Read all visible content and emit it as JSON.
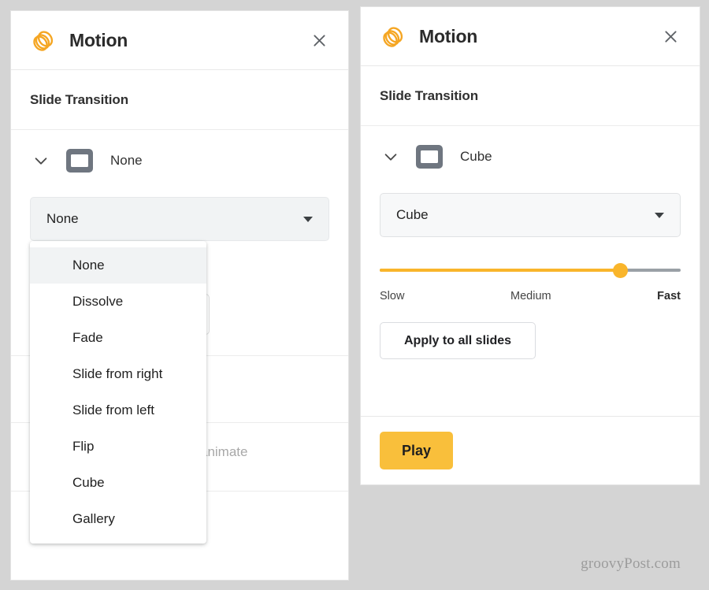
{
  "colors": {
    "brand_orange": "#F5A623",
    "accent_yellow": "#F9BF3B",
    "slider_fill": "#F9B52B",
    "panel_bg": "#FFFFFF",
    "page_bg": "#D4D4D4",
    "select_bg": "#F1F3F4",
    "thumb_gray": "#6F7680"
  },
  "left_panel": {
    "header": {
      "logo_icon": "motion-stacked-circles-icon",
      "title": "Motion",
      "close_icon": "close-icon"
    },
    "section": {
      "title": "Slide Transition"
    },
    "transition_row": {
      "chevron_icon": "chevron-down-icon",
      "slide_icon": "slide-thumbnail-icon",
      "name": "None"
    },
    "select": {
      "value": "None",
      "caret_icon": "caret-down-icon",
      "open": true
    },
    "dropdown": {
      "selected": "None",
      "options": [
        "None",
        "Dissolve",
        "Fade",
        "Slide from right",
        "Slide from left",
        "Flip",
        "Cube",
        "Gallery"
      ]
    },
    "background_content": {
      "placeholder_text": "animate"
    }
  },
  "right_panel": {
    "header": {
      "logo_icon": "motion-stacked-circles-icon",
      "title": "Motion",
      "close_icon": "close-icon"
    },
    "section": {
      "title": "Slide Transition"
    },
    "transition_row": {
      "chevron_icon": "chevron-down-icon",
      "slide_icon": "slide-thumbnail-icon",
      "name": "Cube"
    },
    "select": {
      "value": "Cube",
      "caret_icon": "caret-down-icon",
      "open": false
    },
    "speed_slider": {
      "value_percent": 80,
      "label_min": "Slow",
      "label_mid": "Medium",
      "label_max": "Fast"
    },
    "apply_button": {
      "label": "Apply to all slides"
    },
    "footer": {
      "play_label": "Play"
    }
  },
  "watermark": {
    "text": "groovyPost.com"
  }
}
